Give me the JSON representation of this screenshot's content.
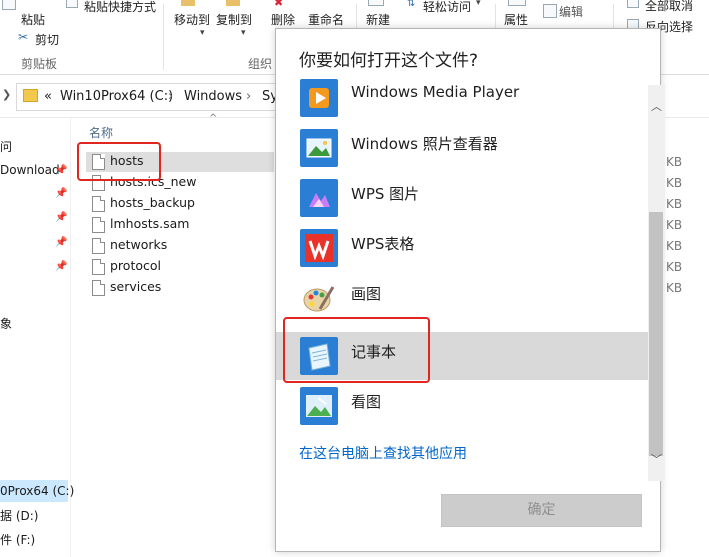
{
  "ribbon": {
    "paste_label": "粘贴",
    "paste_shortcut_label": "粘贴快捷方式",
    "cut_label": "剪切",
    "clipboard_group": "剪贴板",
    "move_to_label": "移动到",
    "copy_to_label": "复制到",
    "delete_label": "删除",
    "rename_label": "重命名",
    "organize_group": "组织",
    "new_label": "新建",
    "easy_access_label": "轻松访问",
    "properties_label": "属性",
    "edit_label": "编辑",
    "select_all_label": "全部取消",
    "invert_selection_label": "反向选择"
  },
  "address": {
    "overflow": "«",
    "crumbs": [
      "Win10Prox64 (C:)",
      "Windows",
      "Sy"
    ]
  },
  "nav": {
    "items": [
      "问",
      "Download",
      "象",
      "0Prox64 (C:)",
      "据 (D:)",
      "件 (F:)"
    ]
  },
  "filelist": {
    "column_name": "名称",
    "files": [
      "hosts",
      "hosts.ics_new",
      "hosts_backup",
      "lmhosts.sam",
      "networks",
      "protocol",
      "services"
    ],
    "sizes": [
      "KB",
      "KB",
      "KB",
      "KB",
      "KB",
      "KB",
      "KB"
    ]
  },
  "dialog": {
    "title": "你要如何打开这个文件?",
    "apps": [
      {
        "label": "Windows Media Player",
        "icon": "media-player-icon"
      },
      {
        "label": "Windows 照片查看器",
        "icon": "photo-viewer-icon"
      },
      {
        "label": "WPS 图片",
        "icon": "wps-image-icon"
      },
      {
        "label": "WPS表格",
        "icon": "wps-spreadsheet-icon"
      },
      {
        "label": "画图",
        "icon": "paint-icon"
      },
      {
        "label": "记事本",
        "icon": "notepad-icon"
      },
      {
        "label": "看图",
        "icon": "image-viewer-icon"
      }
    ],
    "selected_index": 5,
    "more_apps_link": "在这台电脑上查找其他应用",
    "ok_button": "确定"
  },
  "colors": {
    "highlight_red": "#e0261f",
    "link_blue": "#0066cc",
    "selected_row": "#d9d9d9"
  }
}
